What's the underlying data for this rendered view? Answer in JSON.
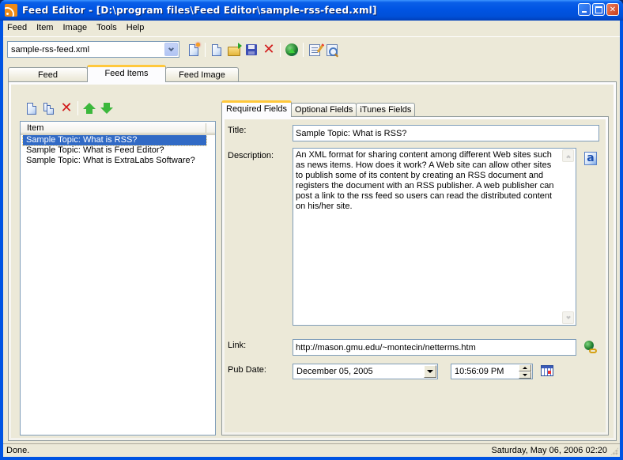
{
  "window": {
    "title": "Feed Editor - [D:\\program files\\Feed Editor\\sample-rss-feed.xml]",
    "app_icon": "rss-icon",
    "controls": [
      "minimize",
      "maximize",
      "close"
    ]
  },
  "menubar": {
    "items": [
      {
        "label": "Feed"
      },
      {
        "label": "Item"
      },
      {
        "label": "Image"
      },
      {
        "label": "Tools"
      },
      {
        "label": "Help"
      }
    ]
  },
  "toolbar": {
    "feed_selector": {
      "value": "sample-rss-feed.xml"
    },
    "buttons": [
      {
        "name": "new-feed",
        "icon": "new-feed-icon"
      },
      {
        "name": "new",
        "icon": "new-document-icon"
      },
      {
        "name": "open",
        "icon": "open-folder-icon"
      },
      {
        "name": "save",
        "icon": "save-icon"
      },
      {
        "name": "delete",
        "icon": "delete-icon"
      },
      {
        "name": "publish",
        "icon": "publish-globe-icon"
      },
      {
        "name": "edit",
        "icon": "edit-icon"
      },
      {
        "name": "preview",
        "icon": "preview-icon"
      }
    ]
  },
  "main_tabs": [
    {
      "label": "Feed",
      "active": false
    },
    {
      "label": "Feed Items",
      "active": true
    },
    {
      "label": "Feed Image",
      "active": false
    }
  ],
  "item_toolbar": {
    "buttons": [
      {
        "name": "add-item",
        "icon": "new-document-icon"
      },
      {
        "name": "duplicate-item",
        "icon": "copy-icon"
      },
      {
        "name": "delete-item",
        "icon": "delete-icon"
      },
      {
        "name": "move-up",
        "icon": "arrow-up-icon"
      },
      {
        "name": "move-down",
        "icon": "arrow-down-icon"
      }
    ]
  },
  "item_list": {
    "column_header": "Item",
    "rows": [
      {
        "label": "Sample Topic: What is RSS?",
        "selected": true
      },
      {
        "label": "Sample Topic: What is Feed Editor?",
        "selected": false
      },
      {
        "label": "Sample Topic: What is ExtraLabs Software?",
        "selected": false
      }
    ]
  },
  "sub_tabs": [
    {
      "label": "Required Fields",
      "active": true
    },
    {
      "label": "Optional Fields",
      "active": false
    },
    {
      "label": "iTunes Fields",
      "active": false
    }
  ],
  "form": {
    "title_label": "Title:",
    "title_value": "Sample Topic: What is RSS?",
    "description_label": "Description:",
    "description_value": "An XML format for sharing content among different Web sites such as news items. How does it work? A Web site can allow other sites to publish some of its content by creating an RSS document and registers the document with an RSS publisher. A web publisher can post a link to the rss feed so users can read the distributed content on his/her site.",
    "link_label": "Link:",
    "link_value": "http://mason.gmu.edu/~montecin/netterms.htm",
    "pubdate_label": "Pub Date:",
    "pubdate_date": "December 05, 2005",
    "pubdate_time": "10:56:09 PM"
  },
  "statusbar": {
    "left": "Done.",
    "right": "Saturday, May 06, 2006 02:20"
  },
  "colors": {
    "titlebar": "#0054e3",
    "selection": "#316ac5",
    "active_tab_accent": "#ffc83c",
    "window_bg": "#ece9d8"
  }
}
